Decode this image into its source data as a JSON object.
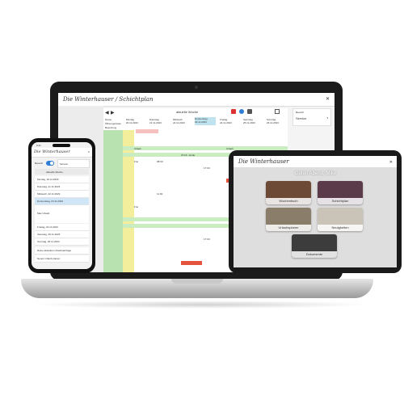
{
  "laptop": {
    "title": "Die Winterhauser / Schichtplan",
    "week_label": "aktuelle Woche",
    "sidebar_label": "Bereich",
    "sidebar_value": "Service",
    "day_headers": [
      {
        "day": "Montag",
        "date": "20.11.2023"
      },
      {
        "day": "Dienstag",
        "date": "21.11.2023"
      },
      {
        "day": "Mittwoch",
        "date": "22.11.2023"
      },
      {
        "day": "Donnerstag",
        "date": "23.11.2023"
      },
      {
        "day": "Freitag",
        "date": "24.11.2023"
      },
      {
        "day": "Samstag",
        "date": "25.11.2023"
      },
      {
        "day": "Sonntag",
        "date": "26.11.2023"
      }
    ],
    "row_labels": [
      "Name",
      "Öffnungszeiten",
      "Besetzung",
      "Info"
    ],
    "cells": [
      "Urlaub",
      "Frei",
      "08:00",
      "15:00 - Ende",
      "17:00",
      "Urlaub",
      "Frei",
      "11:00",
      "Frei",
      "17:00"
    ]
  },
  "phone": {
    "time": "9:41",
    "brand": "Die Winterhauser",
    "toggle_label": "Bereich",
    "area_value": "Service",
    "week_label": "Aktuelle Woche",
    "days": [
      "Montag, 20.11.2023",
      "Dienstag, 21.11.2023",
      "Mittwoch, 22.11.2023",
      "Donnerstag, 23.11.2023",
      "Freitag, 24.11.2023",
      "Samstag, 25.11.2023",
      "Sonntag, 26.11.2023"
    ],
    "detail_label": "Max Urlaub",
    "links": [
      "Deine aktuellen Urlaubsanträge",
      "Neuen Urlaub planen"
    ]
  },
  "tablet": {
    "brand": "Die Winterhauser",
    "greeting": "Guten Abend, Mike",
    "tiles": [
      "Wochenbuch",
      "Schichtplan",
      "Urlaubsplaner",
      "Neuigkeiten",
      "Dokumente"
    ]
  },
  "colors": {
    "green": "#b8e3b0",
    "yellow": "#f3ee9c",
    "red": "#e3533d",
    "accent": "#2f7fd7"
  }
}
